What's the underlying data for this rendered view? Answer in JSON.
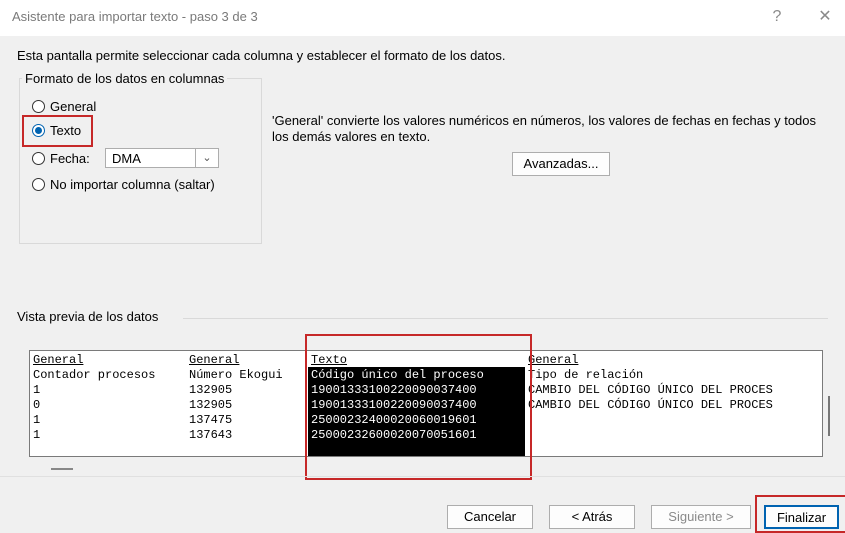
{
  "window": {
    "title": "Asistente para importar texto - paso 3 de 3",
    "help_label": "?",
    "close_label": "✕"
  },
  "description": "Esta pantalla permite seleccionar cada columna y establecer el formato de los datos.",
  "format_group": {
    "legend": "Formato de los datos en columnas",
    "options": [
      {
        "label": "General",
        "checked": false
      },
      {
        "label": "Texto",
        "checked": true
      },
      {
        "label": "Fecha:",
        "checked": false
      },
      {
        "label": "No importar columna (saltar)",
        "checked": false
      }
    ],
    "date_format": {
      "selected": "DMA"
    }
  },
  "info_text": "'General' convierte los valores numéricos en números, los valores de fechas en fechas y todos los demás valores en texto.",
  "advanced_button": "Avanzadas...",
  "preview": {
    "label": "Vista previa de los datos",
    "columns": [
      {
        "header": "General",
        "cells": [
          "Contador procesos",
          "1",
          "0",
          "1",
          "1"
        ],
        "selected": false
      },
      {
        "header": "General",
        "cells": [
          "Número Ekogui",
          "132905",
          "132905",
          "137475",
          "137643"
        ],
        "selected": false
      },
      {
        "header": "Texto",
        "cells": [
          "Código único del proceso",
          "19001333100220090037400",
          "19001333100220090037400",
          "25000232400020060019601",
          "25000232600020070051601"
        ],
        "selected": true
      },
      {
        "header": "General",
        "cells": [
          "Tipo de relación",
          "CAMBIO DEL CÓDIGO ÚNICO DEL PROCES",
          "CAMBIO DEL CÓDIGO ÚNICO DEL PROCES",
          "",
          ""
        ],
        "selected": false
      }
    ]
  },
  "footer": {
    "cancel": "Cancelar",
    "back": "< Atrás",
    "next": "Siguiente >",
    "finish": "Finalizar"
  },
  "colors": {
    "highlight": "#c62828",
    "accent": "#0063b1",
    "selected_column_bg": "#000000"
  }
}
